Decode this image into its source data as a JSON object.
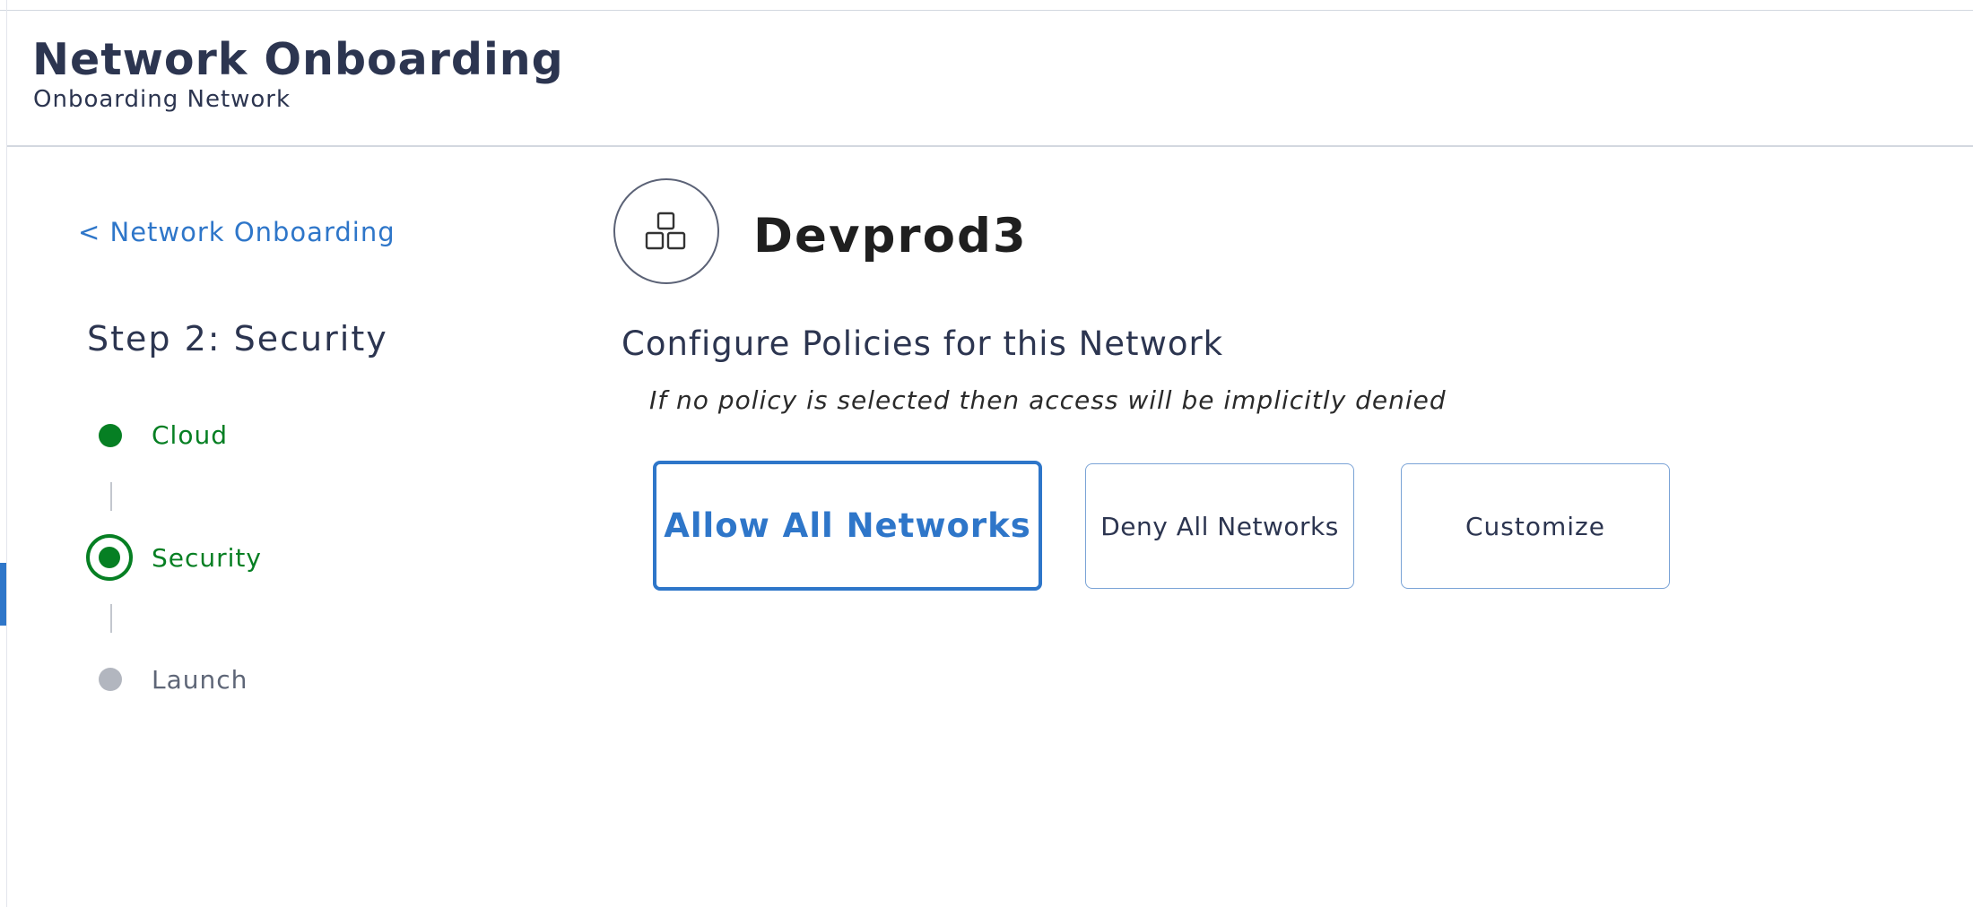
{
  "header": {
    "title": "Network Onboarding",
    "subtitle": "Onboarding Network"
  },
  "sidebar": {
    "back_link": "< Network Onboarding",
    "step_heading": "Step 2: Security",
    "steps": [
      {
        "label": "Cloud",
        "state": "completed",
        "color": "#067f23"
      },
      {
        "label": "Security",
        "state": "current",
        "color": "#067f23"
      },
      {
        "label": "Launch",
        "state": "pending",
        "color": "#b2b6bf"
      }
    ]
  },
  "main": {
    "network_icon": "stacked-boxes-icon",
    "network_name": "Devprod3",
    "policies_heading": "Configure Policies for this Network",
    "policies_note": "If no policy is selected then access will be implicitly denied",
    "options": [
      {
        "label": "Allow All Networks",
        "selected": true
      },
      {
        "label": "Deny All Networks",
        "selected": false
      },
      {
        "label": "Customize",
        "selected": false
      }
    ]
  },
  "colors": {
    "accent": "#2e76c9",
    "heading_text": "#2c3550",
    "success": "#067f23",
    "inactive": "#b2b6bf"
  }
}
